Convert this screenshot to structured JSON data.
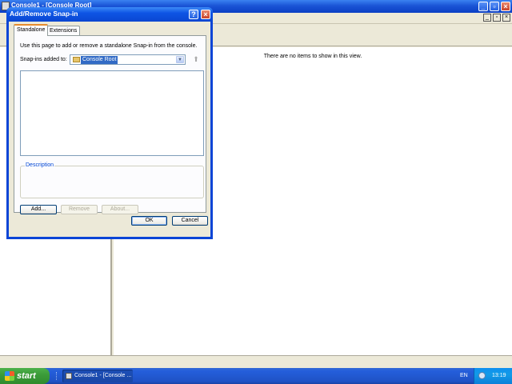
{
  "mmc": {
    "title": "Console1 - [Console Root]",
    "empty_message": "There are no items to show in this view."
  },
  "dialog": {
    "title": "Add/Remove Snap-in",
    "tabs": [
      {
        "label": "Standalone",
        "active": true
      },
      {
        "label": "Extensions",
        "active": false
      }
    ],
    "intro": "Use this page to add or remove a standalone Snap-in from the console.",
    "snapins_label": "Snap-ins added to:",
    "snapins_value": "Console Root",
    "description_label": "Description",
    "buttons": {
      "add": "Add...",
      "remove": "Remove",
      "about": "About...",
      "ok": "OK",
      "cancel": "Cancel"
    }
  },
  "taskbar": {
    "start_label": "start",
    "task_label": "Console1 - [Console ...",
    "language": "EN",
    "clock": "13:19"
  },
  "colors": {
    "xp_blue": "#0a46d1",
    "start_green": "#3c9c3a",
    "selection": "#316ac5",
    "tab_highlight": "#e68b2c"
  }
}
